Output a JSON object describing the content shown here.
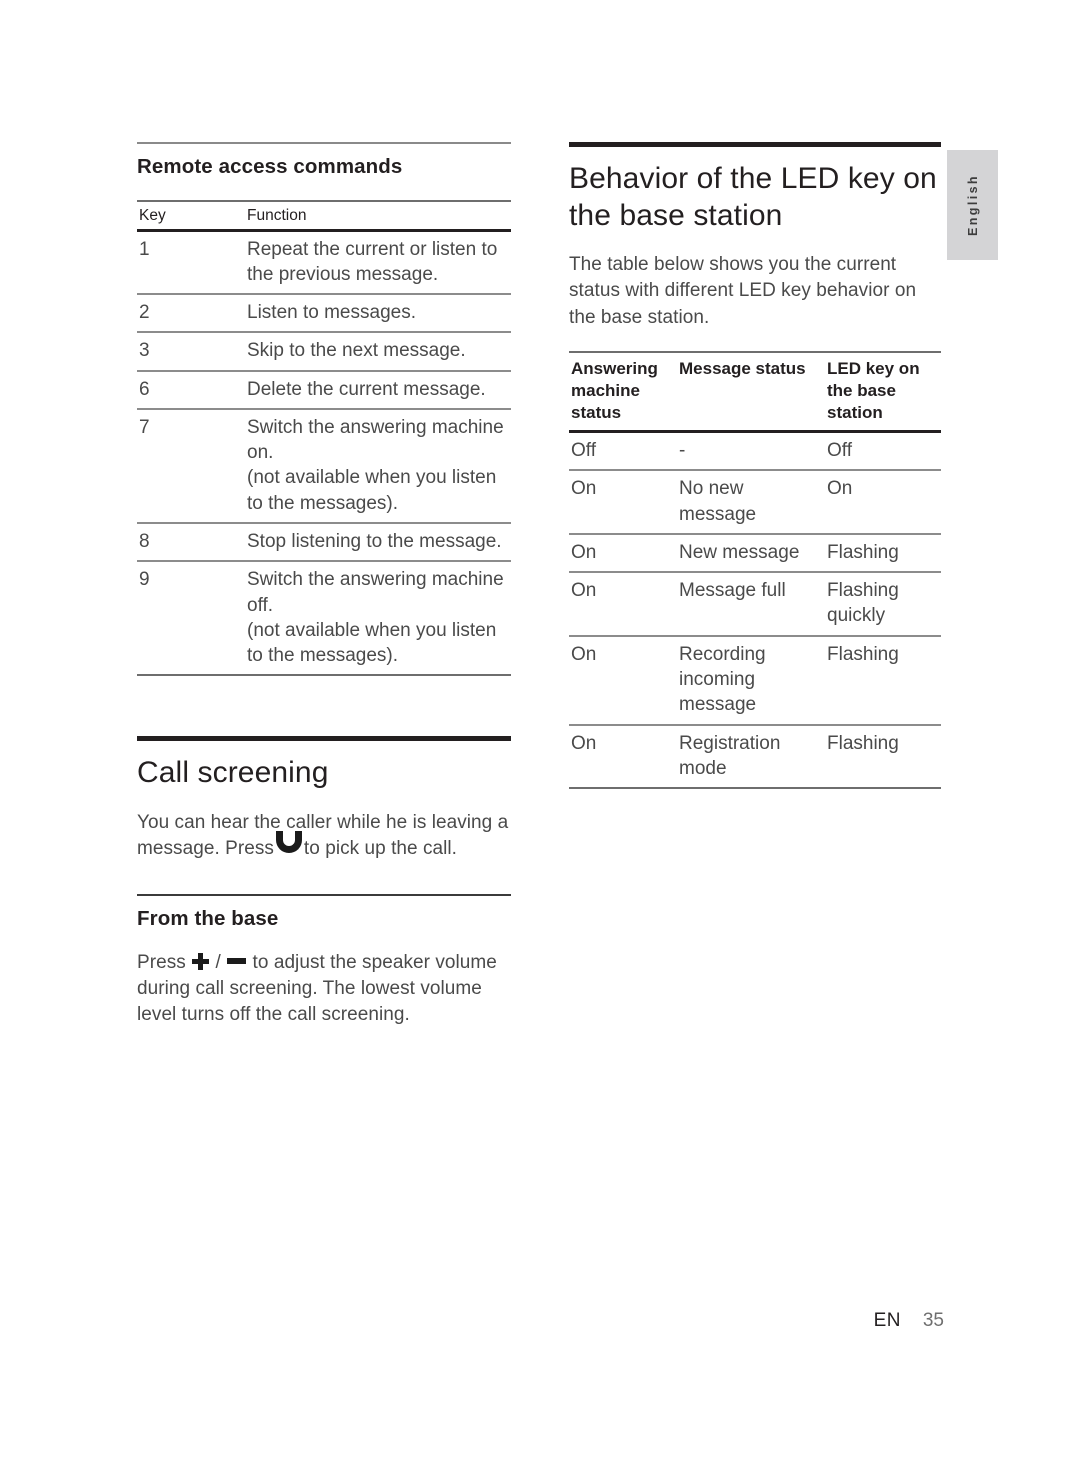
{
  "page": {
    "language_tab": "English",
    "footer": {
      "locale": "EN",
      "page_number": "35"
    }
  },
  "left_column": {
    "subsection": {
      "heading": "Remote access commands",
      "table": {
        "headers": [
          "Key",
          "Function"
        ],
        "rows": [
          [
            "1",
            "Repeat the current or listen to the previous message."
          ],
          [
            "2",
            "Listen to messages."
          ],
          [
            "3",
            "Skip to the next message."
          ],
          [
            "6",
            "Delete the current message."
          ],
          [
            "7",
            "Switch the answering machine on.\n(not available when you listen to the messages)."
          ],
          [
            "8",
            "Stop listening to the message."
          ],
          [
            "9",
            "Switch the answering machine off.\n(not available when you listen to the messages)."
          ]
        ]
      }
    },
    "section": {
      "heading": "Call screening",
      "intro_before_icon": "You can hear the caller while he is leaving a message. Press",
      "intro_icon": "pickup-handset-icon",
      "intro_after_icon": "to pick up the call.",
      "subsection": {
        "heading": "From the base",
        "body_part1": "Press",
        "icon1": "plus-icon",
        "separator": "/",
        "icon2": "minus-icon",
        "body_part2": "to adjust the speaker volume during call screening. The lowest volume level turns off the call screening."
      }
    }
  },
  "right_column": {
    "section": {
      "heading": "Behavior of the LED key on the base station",
      "intro": "The table below shows you the current status with different LED key behavior on the base station.",
      "table": {
        "headers": [
          "Answering machine status",
          "Message status",
          "LED key on the base station"
        ],
        "rows": [
          [
            "Off",
            "-",
            "Off"
          ],
          [
            "On",
            "No new message",
            "On"
          ],
          [
            "On",
            "New message",
            "Flashing"
          ],
          [
            "On",
            "Message full",
            "Flashing quickly"
          ],
          [
            "On",
            "Recording incoming message",
            "Flashing"
          ],
          [
            "On",
            "Registration mode",
            "Flashing"
          ]
        ]
      }
    }
  }
}
